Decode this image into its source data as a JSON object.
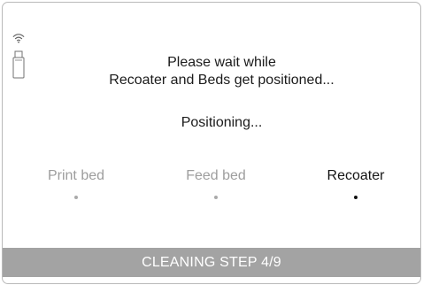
{
  "status": {
    "wifi_icon": "wifi-icon",
    "usb_icon": "usb-icon"
  },
  "message": {
    "line1": "Please wait while",
    "line2": "Recoater and Beds get positioned..."
  },
  "progress_text": "Positioning...",
  "steps": [
    {
      "label": "Print bed",
      "active": false
    },
    {
      "label": "Feed bed",
      "active": false
    },
    {
      "label": "Recoater",
      "active": true
    }
  ],
  "footer": {
    "label": "CLEANING STEP 4/9"
  },
  "colors": {
    "border": "#b9b9b9",
    "text": "#1b1b1b",
    "inactive_step": "#9d9d9d",
    "active_step": "#151515",
    "footer_background": "#a3a3a3",
    "footer_text": "#ffffff"
  }
}
